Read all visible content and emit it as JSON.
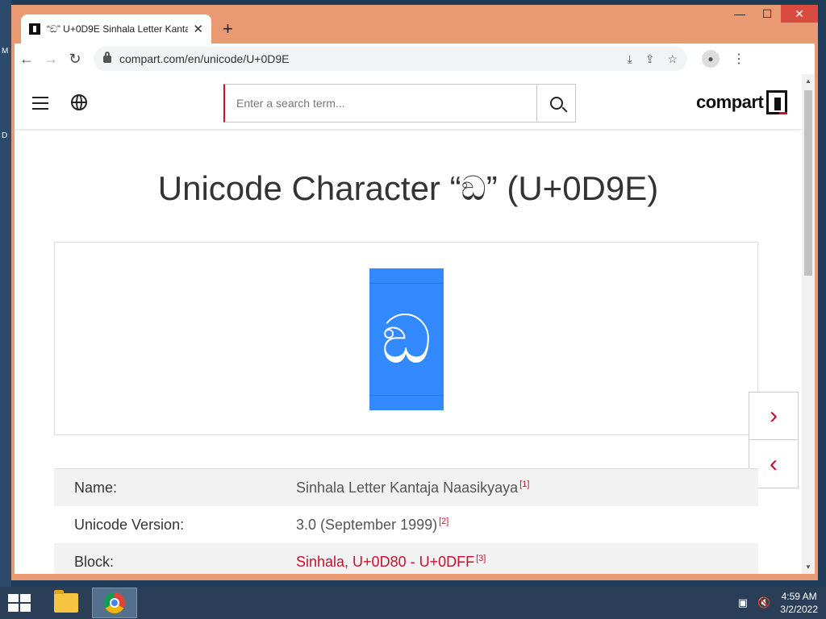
{
  "browser": {
    "tab_title": "“ඞ” U+0D9E Sinhala Letter Kanta",
    "url": "compart.com/en/unicode/U+0D9E"
  },
  "site": {
    "search_placeholder": "Enter a search term...",
    "brand": "compart"
  },
  "page": {
    "title": "Unicode Character “ඞ” (U+0D9E)",
    "glyph": "ඞ"
  },
  "properties": [
    {
      "label": "Name:",
      "value": "Sinhala Letter Kantaja Naasikyaya",
      "ref": "[1]"
    },
    {
      "label": "Unicode Version:",
      "value": "3.0 (September 1999)",
      "ref": "[2]"
    },
    {
      "label": "Block:",
      "value": "Sinhala, U+0D80 - U+0DFF",
      "ref": "[3]"
    }
  ],
  "taskbar": {
    "time": "4:59 AM",
    "date": "3/2/2022"
  },
  "colors": {
    "accent": "#c8102e",
    "glyph_bg": "#3389ff",
    "window_frame": "#e99a73"
  }
}
